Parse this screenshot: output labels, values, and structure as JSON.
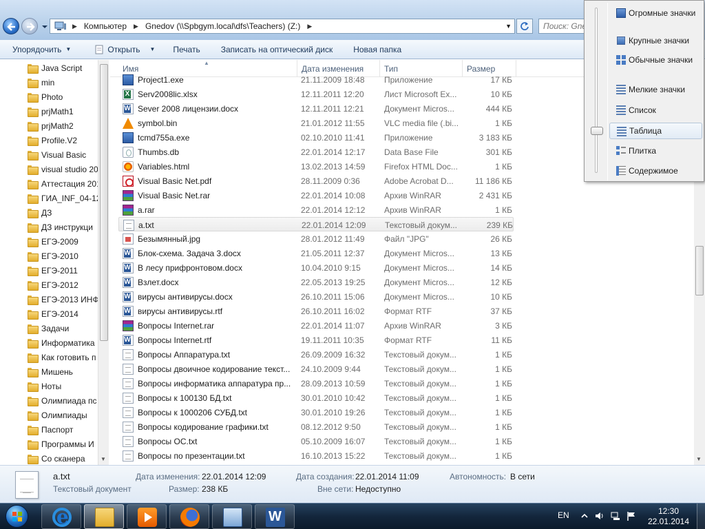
{
  "address": {
    "crumbs": [
      "Компьютер",
      "Gnedov (\\\\Spbgym.local\\dfs\\Teachers) (Z:)"
    ],
    "search_placeholder": "Поиск: Gne"
  },
  "toolbar": {
    "organize": "Упорядочить",
    "open": "Открыть",
    "print": "Печать",
    "burn": "Записать на оптический диск",
    "new_folder": "Новая папка"
  },
  "navpane": {
    "items": [
      "Java Script",
      "min",
      "Photo",
      "prjMath1",
      "prjMath2",
      "Profile.V2",
      "Visual Basic",
      "visual studio 20",
      "Аттестация 201",
      "ГИА_INF_04-12",
      "ДЗ",
      "ДЗ инструкци",
      "ЕГЭ-2009",
      "ЕГЭ-2010",
      "ЕГЭ-2011",
      "ЕГЭ-2012",
      "ЕГЭ-2013 ИНФ",
      "ЕГЭ-2014",
      "Задачи",
      "Информатика",
      "Как готовить п",
      "Мишень",
      "Ноты",
      "Олимпиада пс",
      "Олимпиады",
      "Паспорт",
      "Программы И",
      "Со сканера"
    ]
  },
  "columns": {
    "name": "Имя",
    "date": "Дата изменения",
    "type": "Тип",
    "size": "Размер"
  },
  "files": [
    {
      "name": "Project1.exe",
      "date": "21.11.2009 18:48",
      "type": "Приложение",
      "size": "17 КБ",
      "icon": "exe"
    },
    {
      "name": "Serv2008lic.xlsx",
      "date": "12.11.2011 12:20",
      "type": "Лист Microsoft Ex...",
      "size": "10 КБ",
      "icon": "xls"
    },
    {
      "name": "Sever 2008 лицензии.docx",
      "date": "12.11.2011 12:21",
      "type": "Документ Micros...",
      "size": "444 КБ",
      "icon": "doc"
    },
    {
      "name": "symbol.bin",
      "date": "21.01.2012 11:55",
      "type": "VLC media file (.bi...",
      "size": "1 КБ",
      "icon": "vlc"
    },
    {
      "name": "tcmd755a.exe",
      "date": "02.10.2010 11:41",
      "type": "Приложение",
      "size": "3 183 КБ",
      "icon": "exe"
    },
    {
      "name": "Thumbs.db",
      "date": "22.01.2014 12:17",
      "type": "Data Base File",
      "size": "301 КБ",
      "icon": "db"
    },
    {
      "name": "Variables.html",
      "date": "13.02.2013 14:59",
      "type": "Firefox HTML Doc...",
      "size": "1 КБ",
      "icon": "html"
    },
    {
      "name": "Visual Basic Net.pdf",
      "date": "28.11.2009 0:36",
      "type": "Adobe Acrobat D...",
      "size": "11 186 КБ",
      "icon": "pdf"
    },
    {
      "name": "Visual Basic Net.rar",
      "date": "22.01.2014 10:08",
      "type": "Архив WinRAR",
      "size": "2 431 КБ",
      "icon": "rar"
    },
    {
      "name": "a.rar",
      "date": "22.01.2014 12:12",
      "type": "Архив WinRAR",
      "size": "1 КБ",
      "icon": "rar"
    },
    {
      "name": "a.txt",
      "date": "22.01.2014 12:09",
      "type": "Текстовый докум...",
      "size": "239 КБ",
      "icon": "txt",
      "selected": true
    },
    {
      "name": "Безымянный.jpg",
      "date": "28.01.2012 11:49",
      "type": "Файл \"JPG\"",
      "size": "26 КБ",
      "icon": "jpg"
    },
    {
      "name": "Блок-схема. Задача 3.docx",
      "date": "21.05.2011 12:37",
      "type": "Документ Micros...",
      "size": "13 КБ",
      "icon": "doc"
    },
    {
      "name": "В лесу прифронтовом.docx",
      "date": "10.04.2010 9:15",
      "type": "Документ Micros...",
      "size": "14 КБ",
      "icon": "doc"
    },
    {
      "name": "Взлет.docx",
      "date": "22.05.2013 19:25",
      "type": "Документ Micros...",
      "size": "12 КБ",
      "icon": "doc"
    },
    {
      "name": "вирусы антивирусы.docx",
      "date": "26.10.2011 15:06",
      "type": "Документ Micros...",
      "size": "10 КБ",
      "icon": "doc"
    },
    {
      "name": "вирусы антивирусы.rtf",
      "date": "26.10.2011 16:02",
      "type": "Формат RTF",
      "size": "37 КБ",
      "icon": "doc"
    },
    {
      "name": "Вопросы Internet.rar",
      "date": "22.01.2014 11:07",
      "type": "Архив WinRAR",
      "size": "3 КБ",
      "icon": "rar"
    },
    {
      "name": "Вопросы Internet.rtf",
      "date": "19.11.2011 10:35",
      "type": "Формат RTF",
      "size": "11 КБ",
      "icon": "doc"
    },
    {
      "name": "Вопросы Аппаратура.txt",
      "date": "26.09.2009 16:32",
      "type": "Текстовый докум...",
      "size": "1 КБ",
      "icon": "txt"
    },
    {
      "name": "Вопросы двоичное кодирование текст...",
      "date": "24.10.2009 9:44",
      "type": "Текстовый докум...",
      "size": "1 КБ",
      "icon": "txt"
    },
    {
      "name": "Вопросы информатика аппаратура пр...",
      "date": "28.09.2013 10:59",
      "type": "Текстовый докум...",
      "size": "1 КБ",
      "icon": "txt"
    },
    {
      "name": "Вопросы к 100130 БД.txt",
      "date": "30.01.2010 10:42",
      "type": "Текстовый докум...",
      "size": "1 КБ",
      "icon": "txt"
    },
    {
      "name": "Вопросы к 1000206 СУБД.txt",
      "date": "30.01.2010 19:26",
      "type": "Текстовый докум...",
      "size": "1 КБ",
      "icon": "txt"
    },
    {
      "name": "Вопросы кодирование графики.txt",
      "date": "08.12.2012 9:50",
      "type": "Текстовый докум...",
      "size": "1 КБ",
      "icon": "txt"
    },
    {
      "name": "Вопросы ОС.txt",
      "date": "05.10.2009 16:07",
      "type": "Текстовый докум...",
      "size": "1 КБ",
      "icon": "txt"
    },
    {
      "name": "Вопросы по презентации.txt",
      "date": "16.10.2013 15:22",
      "type": "Текстовый докум...",
      "size": "1 КБ",
      "icon": "txt"
    }
  ],
  "view_menu": {
    "items": [
      {
        "label": "Огромные значки",
        "icon": "big"
      },
      {
        "label": "Крупные значки",
        "icon": "med"
      },
      {
        "label": "Обычные значки",
        "icon": "norm"
      },
      {
        "label": "Мелкие значки",
        "icon": "small"
      },
      {
        "label": "Список",
        "icon": "list"
      },
      {
        "label": "Таблица",
        "icon": "details",
        "active": true
      },
      {
        "label": "Плитка",
        "icon": "tiles"
      },
      {
        "label": "Содержимое",
        "icon": "content"
      }
    ]
  },
  "details": {
    "filename": "a.txt",
    "filetype": "Текстовый документ",
    "modified_label": "Дата изменения:",
    "modified_value": "22.01.2014 12:09",
    "size_label": "Размер:",
    "size_value": "238 КБ",
    "created_label": "Дата создания:",
    "created_value": "22.01.2014 11:09",
    "offline_label": "Вне сети:",
    "offline_value": "Недоступно",
    "availability_label": "Автономность:",
    "availability_value": "В сети"
  },
  "taskbar": {
    "apps": [
      {
        "name": "internet-explorer",
        "state": "pinned"
      },
      {
        "name": "windows-explorer",
        "state": "active"
      },
      {
        "name": "media-player",
        "state": "pinned"
      },
      {
        "name": "firefox",
        "state": "pinned"
      },
      {
        "name": "remote-desktop",
        "state": "pinned"
      },
      {
        "name": "microsoft-word",
        "state": "pinned"
      }
    ],
    "language": "EN",
    "time": "12:30",
    "date": "22.01.2014"
  }
}
